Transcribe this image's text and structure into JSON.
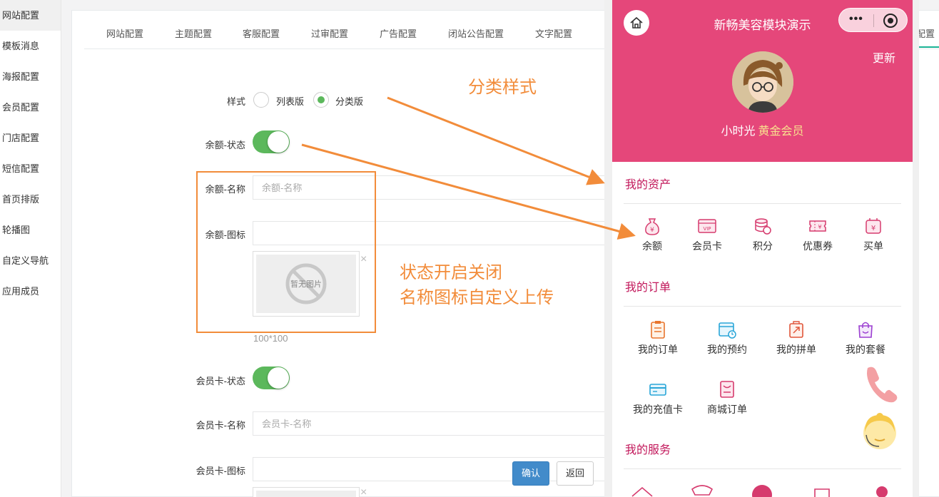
{
  "sidebar": {
    "items": [
      {
        "label": "网站配置",
        "active": true
      },
      {
        "label": "模板消息"
      },
      {
        "label": "海报配置"
      },
      {
        "label": "会员配置"
      },
      {
        "label": "门店配置"
      },
      {
        "label": "短信配置"
      },
      {
        "label": "首页排版"
      },
      {
        "label": "轮播图"
      },
      {
        "label": "自定义导航"
      },
      {
        "label": "应用成员"
      }
    ]
  },
  "tabs": [
    "网站配置",
    "主题配置",
    "客服配置",
    "过审配置",
    "广告配置",
    "闭站公告配置",
    "文字配置",
    "配置"
  ],
  "form": {
    "style_label": "样式",
    "style_options": [
      "列表版",
      "分类版"
    ],
    "balance_status_label": "余额-状态",
    "balance_name_label": "余额-名称",
    "balance_name_placeholder": "余额-名称",
    "balance_icon_label": "余额-图标",
    "no_image_text": "暂无图片",
    "image_size_hint": "100*100",
    "card_status_label": "会员卡-状态",
    "card_name_label": "会员卡-名称",
    "card_name_placeholder": "会员卡-名称",
    "card_icon_label": "会员卡-图标",
    "close_symbol": "×",
    "confirm_button": "确认",
    "back_button": "返回"
  },
  "annotations": {
    "category_style": "分类样式",
    "status_line1": "状态开启关闭",
    "status_line2": "名称图标自定义上传"
  },
  "phone": {
    "app_title": "新畅美容模块演示",
    "capsule_dots": "•••",
    "refresh": "更新",
    "username": "小时光",
    "member_level": "黄金会员",
    "assets_title": "我的资产",
    "assets": [
      "余额",
      "会员卡",
      "积分",
      "优惠券",
      "买单"
    ],
    "orders_title": "我的订单",
    "orders": [
      "我的订单",
      "我的预约",
      "我的拼单",
      "我的套餐",
      "我的充值卡",
      "商城订单"
    ],
    "services_title": "我的服务"
  },
  "colors": {
    "accent_green": "#5cb85c",
    "phone_header": "#e5477a",
    "section_title": "#c2185b",
    "annotation_orange": "#f28c3a",
    "primary_button": "#428bca"
  }
}
